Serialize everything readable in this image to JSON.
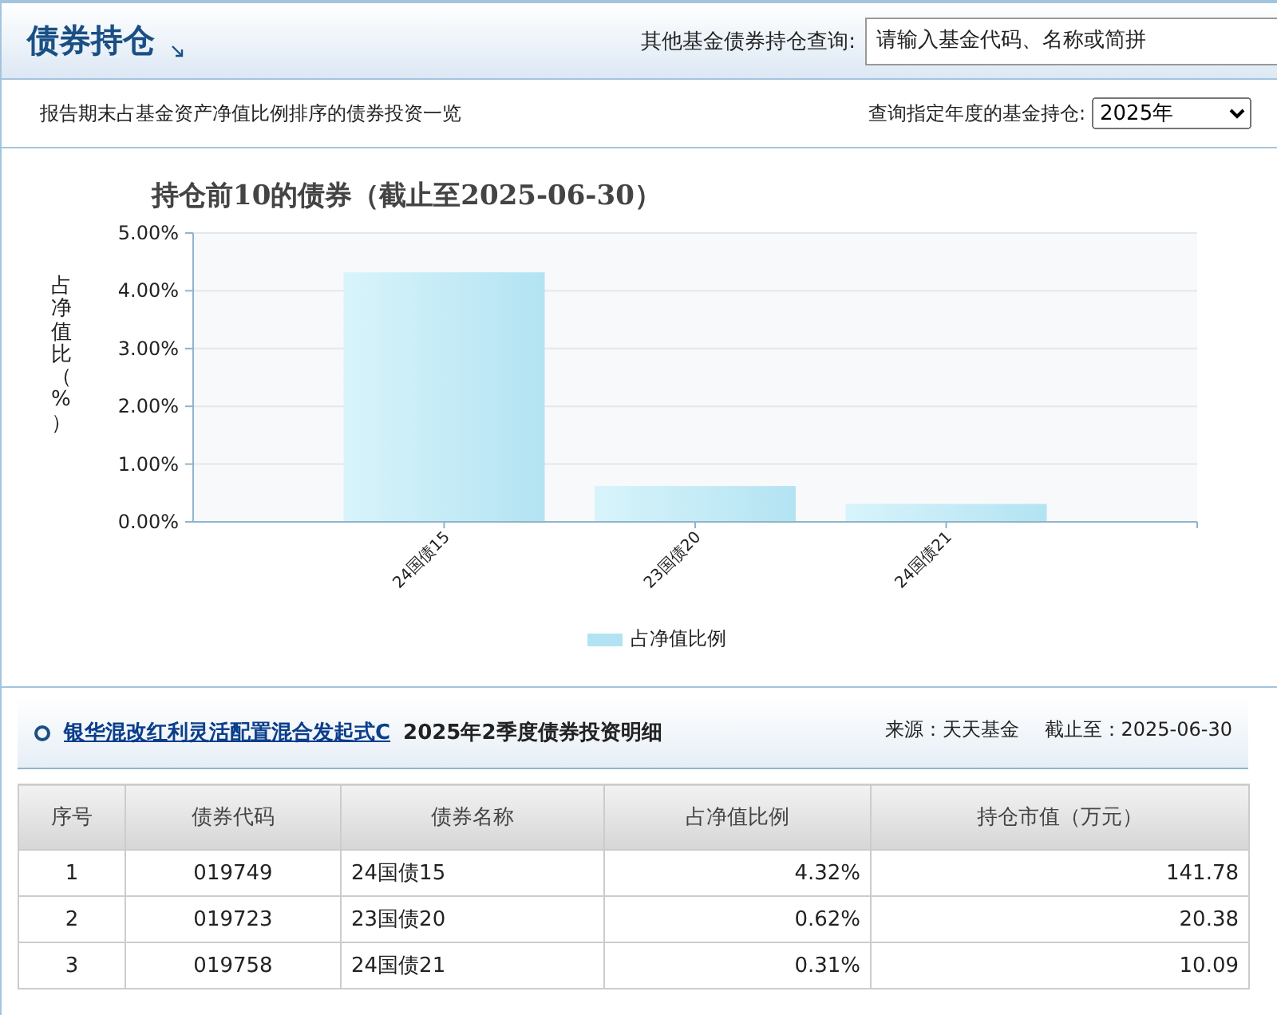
{
  "header": {
    "title": "债券持仓",
    "search_label": "其他基金债券持仓查询:",
    "search_placeholder": "请输入基金代码、名称或简拼"
  },
  "toolbar": {
    "description": "报告期末占基金资产净值比例排序的债券投资一览",
    "year_label": "查询指定年度的基金持仓:",
    "year_value": "2025年"
  },
  "chart_data": {
    "type": "bar",
    "title": "持仓前10的债券（截止至2025-06-30）",
    "ylabel": "占净值比（%）",
    "categories": [
      "24国债15",
      "23国债20",
      "24国债21"
    ],
    "series": [
      {
        "name": "占净值比例",
        "color": "#b3e3f2",
        "values": [
          4.32,
          0.62,
          0.31
        ]
      }
    ],
    "grid": true,
    "ylim": [
      0,
      5
    ],
    "yticks": [
      {
        "value": 0,
        "label": "0.00%"
      },
      {
        "value": 1,
        "label": "1.00%"
      },
      {
        "value": 2,
        "label": "2.00%"
      },
      {
        "value": 3,
        "label": "3.00%"
      },
      {
        "value": 4,
        "label": "4.00%"
      },
      {
        "value": 5,
        "label": "5.00%"
      }
    ]
  },
  "section": {
    "fund_link": "银华混改红利灵活配置混合发起式C",
    "title": "2025年2季度债券投资明细",
    "source": "来源：天天基金",
    "as_of": "截止至：2025-06-30"
  },
  "table": {
    "columns": [
      "序号",
      "债券代码",
      "债券名称",
      "占净值比例",
      "持仓市值（万元）"
    ],
    "rows": [
      [
        "1",
        "019749",
        "24国债15",
        "4.32%",
        "141.78"
      ],
      [
        "2",
        "019723",
        "23国债20",
        "0.62%",
        "20.38"
      ],
      [
        "3",
        "019758",
        "24国债21",
        "0.31%",
        "10.09"
      ]
    ]
  }
}
